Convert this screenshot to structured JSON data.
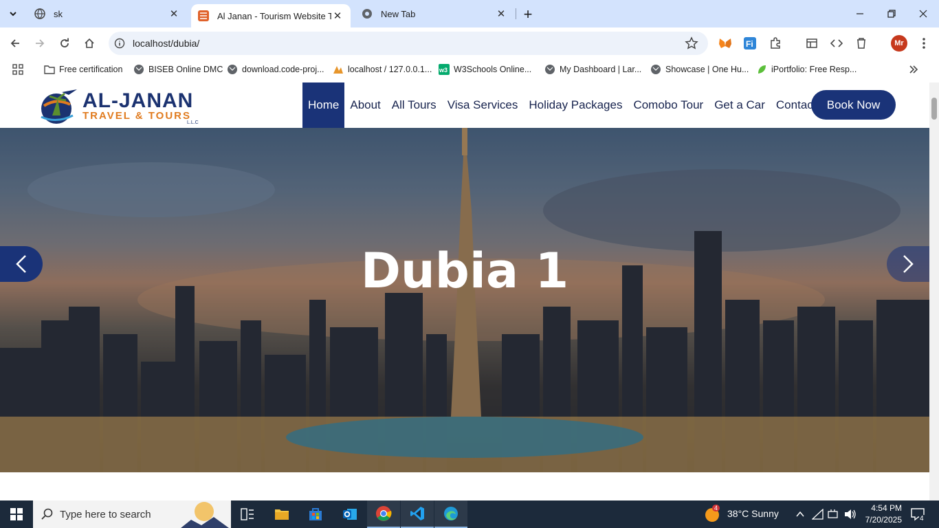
{
  "browser": {
    "tabs": [
      {
        "title": "sk",
        "active": false
      },
      {
        "title": "Al Janan - Tourism Website Template",
        "active": true
      },
      {
        "title": "New Tab",
        "active": false
      }
    ],
    "url": "localhost/dubia/"
  },
  "bookmarks": [
    {
      "label": "Free certification",
      "icon": "folder-icon"
    },
    {
      "label": "BISEB Online DMC",
      "icon": "globe-icon"
    },
    {
      "label": "download.code-proj...",
      "icon": "globe-icon"
    },
    {
      "label": "localhost / 127.0.0.1...",
      "icon": "phpmyadmin-icon"
    },
    {
      "label": "W3Schools Online...",
      "icon": "w3schools-icon"
    },
    {
      "label": "My Dashboard | Lar...",
      "icon": "globe-icon"
    },
    {
      "label": "Showcase | One Hu...",
      "icon": "globe-icon"
    },
    {
      "label": "iPortfolio: Free Resp...",
      "icon": "leaf-icon"
    }
  ],
  "site": {
    "logo": {
      "line1": "AL-JANAN",
      "line2": "TRAVEL & TOURS",
      "line3": "L.L.C"
    },
    "nav": [
      {
        "label": "Home",
        "active": true
      },
      {
        "label": "About",
        "active": false
      },
      {
        "label": "All Tours",
        "active": false
      },
      {
        "label": "Visa Services",
        "active": false
      },
      {
        "label": "Holiday Packages",
        "active": false
      },
      {
        "label": "Comobo Tour",
        "active": false
      },
      {
        "label": "Get a Car",
        "active": false
      },
      {
        "label": "Contact",
        "active": false
      }
    ],
    "cta": "Book Now",
    "hero_title": "Dubia 1",
    "accent": "#1a3378",
    "brand_orange": "#e07b1f"
  },
  "taskbar": {
    "search_placeholder": "Type here to search",
    "weather": "38°C  Sunny",
    "weather_badge": "4",
    "time": "4:54 PM",
    "date": "7/20/2025",
    "notifications": "4"
  }
}
